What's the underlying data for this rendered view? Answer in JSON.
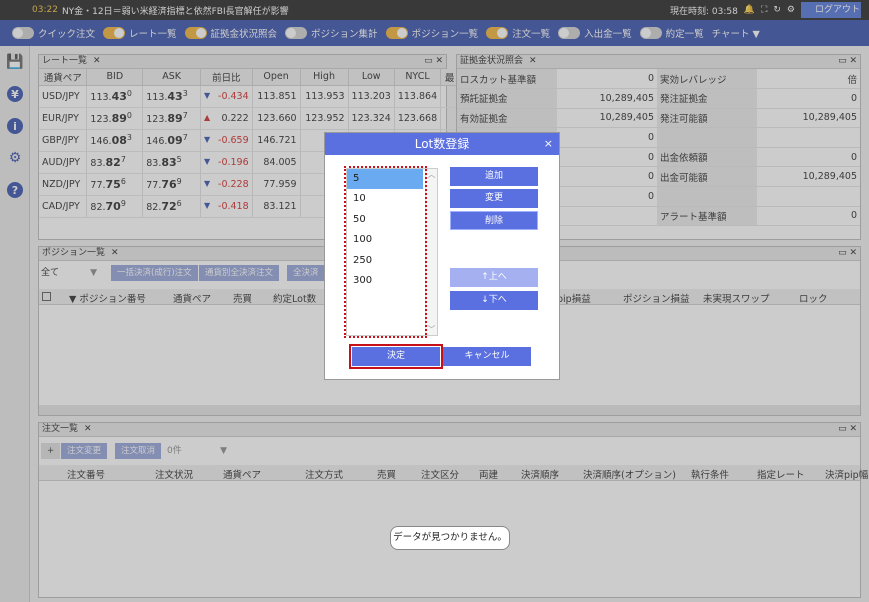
{
  "ticker": {
    "time": "03:22",
    "headline": "NY金・12日＝弱い米経済指標と依然FBI長官解任が影響",
    "clock_label": "現在時刻: 03:58",
    "logout_label": "ログアウト"
  },
  "nav": {
    "items": [
      {
        "label": "クイック注文",
        "on": false
      },
      {
        "label": "レート一覧",
        "on": true
      },
      {
        "label": "証拠金状況照会",
        "on": true
      },
      {
        "label": "ポジション集計",
        "on": false
      },
      {
        "label": "ポジション一覧",
        "on": true
      },
      {
        "label": "注文一覧",
        "on": true
      },
      {
        "label": "入出金一覧",
        "on": false
      },
      {
        "label": "約定一覧",
        "on": false
      }
    ],
    "chart_label": "チャート ▼"
  },
  "rate_panel": {
    "title": "レート一覧",
    "headers": [
      "通貨ペア",
      "BID",
      "ASK",
      "前日比",
      "Open",
      "High",
      "Low",
      "NYCL",
      "最"
    ],
    "rows": [
      {
        "pair": "USD/JPY",
        "bid_a": "113.",
        "bid_b": "43",
        "bid_c": "0",
        "ask_a": "113.",
        "ask_b": "43",
        "ask_c": "3",
        "dir": "down",
        "change": "-0.434",
        "open": "113.851",
        "high": "113.953",
        "low": "113.203",
        "nycl": "113.864"
      },
      {
        "pair": "EUR/JPY",
        "bid_a": "123.",
        "bid_b": "89",
        "bid_c": "0",
        "ask_a": "123.",
        "ask_b": "89",
        "ask_c": "7",
        "dir": "up",
        "change": "0.222",
        "open": "123.660",
        "high": "123.952",
        "low": "123.324",
        "nycl": "123.668"
      },
      {
        "pair": "GBP/JPY",
        "bid_a": "146.",
        "bid_b": "08",
        "bid_c": "3",
        "ask_a": "146.",
        "ask_b": "09",
        "ask_c": "7",
        "dir": "down",
        "change": "-0.659",
        "open": "146.721",
        "high": "146.",
        "low": "",
        "nycl": ""
      },
      {
        "pair": "AUD/JPY",
        "bid_a": "83.",
        "bid_b": "82",
        "bid_c": "7",
        "ask_a": "83.",
        "ask_b": "83",
        "ask_c": "5",
        "dir": "down",
        "change": "-0.196",
        "open": "84.005",
        "high": "84.",
        "low": "",
        "nycl": ""
      },
      {
        "pair": "NZD/JPY",
        "bid_a": "77.",
        "bid_b": "75",
        "bid_c": "6",
        "ask_a": "77.",
        "ask_b": "76",
        "ask_c": "9",
        "dir": "down",
        "change": "-0.228",
        "open": "77.959",
        "high": "77.",
        "low": "",
        "nycl": ""
      },
      {
        "pair": "CAD/JPY",
        "bid_a": "82.",
        "bid_b": "70",
        "bid_c": "9",
        "ask_a": "82.",
        "ask_b": "72",
        "ask_c": "6",
        "dir": "down",
        "change": "-0.418",
        "open": "83.121",
        "high": "83.",
        "low": "",
        "nycl": ""
      }
    ]
  },
  "margin_panel": {
    "title": "証拠金状況照会",
    "rows": [
      {
        "l1": "ロスカット基準額",
        "v1": "0",
        "l2": "実効レバレッジ",
        "v2": "倍"
      },
      {
        "l1": "預託証拠金",
        "v1": "10,289,405",
        "l2": "発注証拠金",
        "v2": "0"
      },
      {
        "l1": "有効証拠金",
        "v1": "10,289,405",
        "l2": "発注可能額",
        "v2": "10,289,405"
      },
      {
        "l1": "",
        "v1": "0",
        "l2": "",
        "v2": ""
      },
      {
        "l1": "",
        "v1": "0",
        "l2": "出金依頼額",
        "v2": "0"
      },
      {
        "l1": "",
        "v1": "0",
        "l2": "出金可能額",
        "v2": "10,289,405"
      },
      {
        "l1": "",
        "v1": "0",
        "l2": "",
        "v2": ""
      },
      {
        "l1": "",
        "v1": "",
        "l2": "アラート基準額",
        "v2": "0"
      }
    ]
  },
  "position_panel": {
    "title": "ポジション一覧",
    "filter": "全て",
    "btn1": "一括決済(成行)注文",
    "btn2": "通貨別全決済注文",
    "btn3": "全決済",
    "headers": [
      "▼ ポジション番号",
      "通貨ペア",
      "売買",
      "約定Lot数",
      "pip損益",
      "ポジション損益",
      "未実現スワップ",
      "ロック"
    ]
  },
  "order_panel": {
    "title": "注文一覧",
    "btn_add": "+",
    "btn_change": "注文変更",
    "btn_cancel": "注文取消",
    "count": "0件",
    "headers": [
      "注文番号",
      "注文状況",
      "通貨ペア",
      "注文方式",
      "売買",
      "注文区分",
      "両建",
      "決済順序",
      "決済順序(オプション)",
      "執行条件",
      "指定レート",
      "決済pip幅"
    ],
    "empty": "データが見つかりません。"
  },
  "dialog": {
    "title": "Lot数登録",
    "close": "×",
    "options": [
      "5",
      "10",
      "50",
      "100",
      "250",
      "300"
    ],
    "selected": "5",
    "add": "追加",
    "change": "変更",
    "delete": "削除",
    "up": "↑上へ",
    "down": "↓下へ",
    "ok": "決定",
    "cancel": "キャンセル"
  },
  "accent": "#2f4aa8"
}
